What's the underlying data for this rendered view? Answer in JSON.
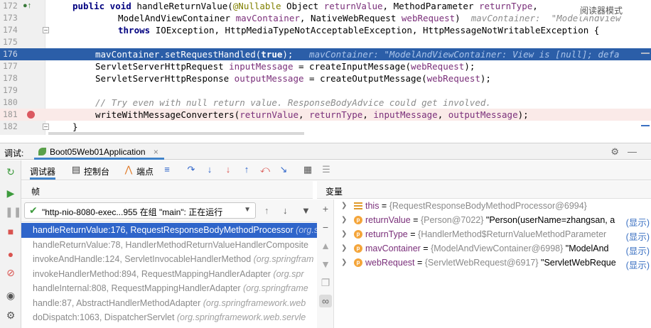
{
  "editor": {
    "reader_mode": "阅读器模式",
    "lines": [
      {
        "no": "172"
      },
      {
        "no": "173"
      },
      {
        "no": "174"
      },
      {
        "no": "175"
      },
      {
        "no": "176"
      },
      {
        "no": "177"
      },
      {
        "no": "178"
      },
      {
        "no": "179"
      },
      {
        "no": "180"
      },
      {
        "no": "181"
      },
      {
        "no": "182"
      }
    ],
    "code": {
      "l172_kw1": "public void ",
      "l172_a": "handleReturnValue(",
      "l172_ann": "@Nullable ",
      "l172_b": "Object ",
      "l172_p1": "returnValue",
      "l172_c": ", MethodParameter ",
      "l172_p2": "returnType",
      "l172_d": ",",
      "l173_a": "ModelAndViewContainer ",
      "l173_p1": "mavContainer",
      "l173_b": ", NativeWebRequest ",
      "l173_p2": "webRequest",
      "l173_c": ")",
      "l173_hint": "mavContainer:  \"ModelAndView",
      "l174_kw": "throws ",
      "l174_a": "IOException, HttpMediaTypeNotAcceptableException, HttpMessageNotWritableException {",
      "l176_a": "mavContainer.setRequestHandled(",
      "l176_kw": "true",
      "l176_b": ");",
      "l176_hint": "mavContainer: \"ModelAndViewContainer: View is [null]; defa",
      "l177_a": "ServletServerHttpRequest ",
      "l177_p": "inputMessage",
      "l177_b": " = createInputMessage(",
      "l177_p2": "webRequest",
      "l177_c": ");",
      "l178_a": "ServletServerHttpResponse ",
      "l178_p": "outputMessage",
      "l178_b": " = createOutputMessage(",
      "l178_p2": "webRequest",
      "l178_c": ");",
      "l180_cmt": "// Try even with null return value. ResponseBodyAdvice could get involved.",
      "l181_a": "writeWithMessageConverters(",
      "l181_p1": "returnValue",
      "l181_s1": ", ",
      "l181_p2": "returnType",
      "l181_s2": ", ",
      "l181_p3": "inputMessage",
      "l181_s3": ", ",
      "l181_p4": "outputMessage",
      "l181_b": ");",
      "l182_a": "}"
    }
  },
  "debug_bar": {
    "label": "调试:",
    "run_tab": "Boot05Web01Application",
    "close": "×"
  },
  "toolbar": {
    "tab_debugger": "调试器",
    "tab_console": "控制台",
    "tab_breakpoints": "端点"
  },
  "frames": {
    "header": "帧",
    "thread": "\"http-nio-8080-exec...955 在组 \"main\": 正在运行",
    "items": [
      {
        "method": "handleReturnValue:176, RequestResponseBodyMethodProcessor ",
        "pkg": "(org.spr"
      },
      {
        "method": "handleReturnValue:78, HandlerMethodReturnValueHandlerComposite",
        "pkg": ""
      },
      {
        "method": "invokeAndHandle:124, ServletInvocableHandlerMethod ",
        "pkg": "(org.springfram"
      },
      {
        "method": "invokeHandlerMethod:894, RequestMappingHandlerAdapter ",
        "pkg": "(org.spr"
      },
      {
        "method": "handleInternal:808, RequestMappingHandlerAdapter ",
        "pkg": "(org.springframe"
      },
      {
        "method": "handle:87, AbstractHandlerMethodAdapter ",
        "pkg": "(org.springframework.web"
      },
      {
        "method": "doDispatch:1063, DispatcherServlet ",
        "pkg": "(org.springframework.web.servle"
      }
    ]
  },
  "variables": {
    "header": "变量",
    "show": "(显示)",
    "items": [
      {
        "name": "this",
        "type": "{RequestResponseBodyMethodProcessor@6994}",
        "value": "",
        "icon": "lines"
      },
      {
        "name": "returnValue",
        "type": "{Person@7022}",
        "value": "\"Person(userName=zhangsan, a",
        "icon": "p"
      },
      {
        "name": "returnType",
        "type": "{HandlerMethod$ReturnValueMethodParameter",
        "value": "",
        "icon": "p"
      },
      {
        "name": "mavContainer",
        "type": "{ModelAndViewContainer@6998}",
        "value": "\"ModelAnd",
        "icon": "p"
      },
      {
        "name": "webRequest",
        "type": "{ServletWebRequest@6917}",
        "value": "\"ServletWebReque",
        "icon": "p"
      }
    ]
  }
}
